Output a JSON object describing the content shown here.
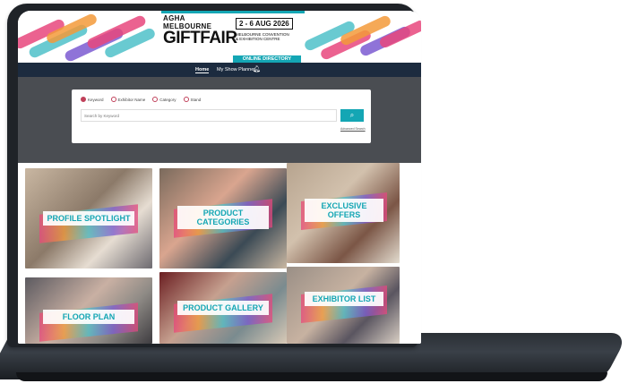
{
  "header": {
    "logo_top": "AGHA MELBOURNE",
    "logo_main": "GIFTFAIR",
    "logo_tagline": "",
    "dates": "2 - 6 AUG 2026",
    "venue_line1": "MELBOURNE CONVENTION",
    "venue_line2": "& EXHIBITION CENTRE",
    "online_directory": "ONLINE DIRECTORY"
  },
  "nav": {
    "home": "Home",
    "planner": "My Show Planner",
    "bell_icon": "bell-icon"
  },
  "search": {
    "options": [
      "Keyword",
      "Exhibitor Name",
      "Category",
      "Stand"
    ],
    "selected": "Keyword",
    "placeholder": "Search by Keyword",
    "button_icon": "search-icon",
    "advanced": "Advanced Search"
  },
  "tiles": [
    {
      "label": "PROFILE SPOTLIGHT"
    },
    {
      "label": "PRODUCT CATEGORIES"
    },
    {
      "label": "EXCLUSIVE OFFERS"
    },
    {
      "label": "FLOOR PLAN"
    },
    {
      "label": "PRODUCT GALLERY"
    },
    {
      "label": "EXHIBITOR LIST"
    }
  ],
  "colors": {
    "accent": "#14a6b4",
    "nav_bg": "#1c2b3f",
    "search_bg": "#4a4d52",
    "radio": "#c0405a"
  }
}
